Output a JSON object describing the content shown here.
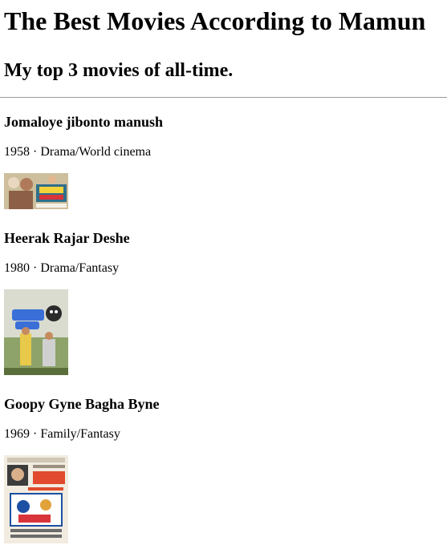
{
  "page": {
    "title": "The Best Movies According to Mamun",
    "subtitle": "My top 3 movies of all-time."
  },
  "movies": [
    {
      "title": "Jomaloye jibonto manush",
      "meta": "1958 · Drama/World cinema",
      "poster_alt": "Jomaloye jibonto manush poster"
    },
    {
      "title": "Heerak Rajar Deshe",
      "meta": "1980 · Drama/Fantasy",
      "poster_alt": "Heerak Rajar Deshe poster"
    },
    {
      "title": "Goopy Gyne Bagha Byne",
      "meta": "1969 · Family/Fantasy",
      "poster_alt": "Goopy Gyne Bagha Byne poster"
    }
  ]
}
